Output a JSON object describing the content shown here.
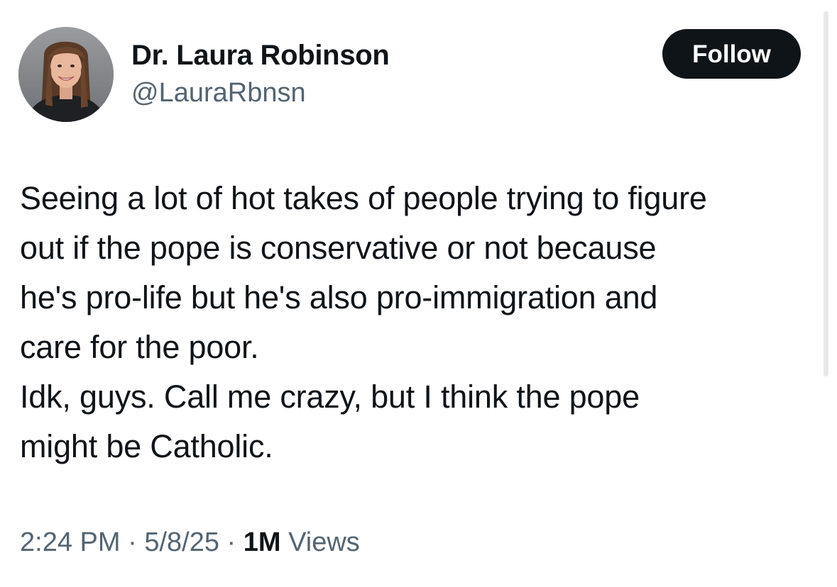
{
  "author": {
    "display_name": "Dr. Laura Robinson",
    "handle": "@LauraRbnsn"
  },
  "follow_label": "Follow",
  "tweet": {
    "lines": [
      "Seeing a lot of hot takes of people trying to figure",
      "out if the pope is conservative or not because",
      "he's pro-life but he's also pro-immigration and",
      "care for the poor.",
      "Idk, guys. Call me crazy, but I think the pope",
      "might be Catholic."
    ]
  },
  "meta": {
    "time": "2:24 PM",
    "separator": "·",
    "date": "5/8/25",
    "views_count": "1M",
    "views_label": "Views"
  },
  "colors": {
    "text_primary": "#0f1419",
    "text_secondary": "#536471",
    "button_bg": "#0f1419",
    "button_text": "#ffffff"
  }
}
